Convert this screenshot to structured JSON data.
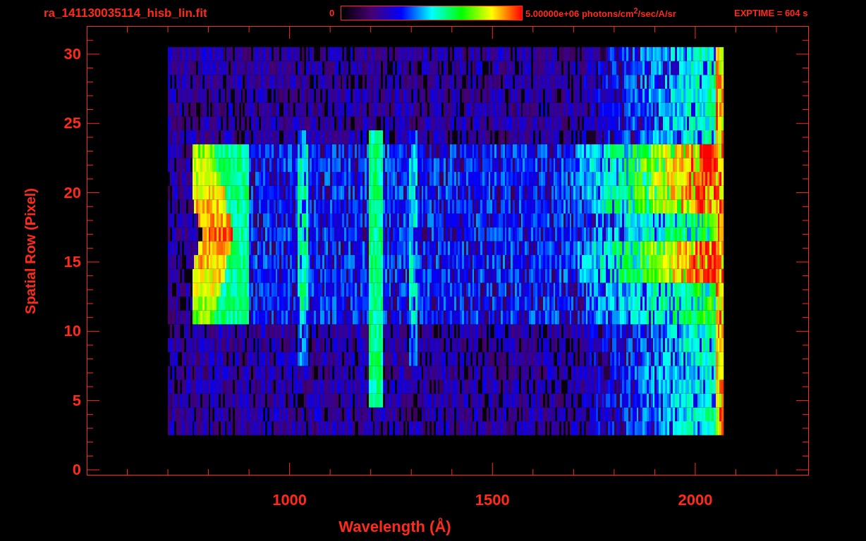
{
  "header": {
    "file_name": "ra_141130035114_hisb_lin.fit",
    "colorbar": {
      "min_label": "0",
      "max_label": "5.00000e+06 photons/cm$^{2}$/sec/A/sr"
    },
    "exposure": "EXPTIME = 604 s"
  },
  "plot": {
    "y_label": "Spatial Row (Pixel)",
    "y_ticks": [
      "30",
      "25",
      "20",
      "15",
      "10",
      "5",
      "0"
    ],
    "x_ticks": [
      "1000",
      "1500",
      "2000"
    ],
    "x_label": "Wavelength (Å)"
  }
}
